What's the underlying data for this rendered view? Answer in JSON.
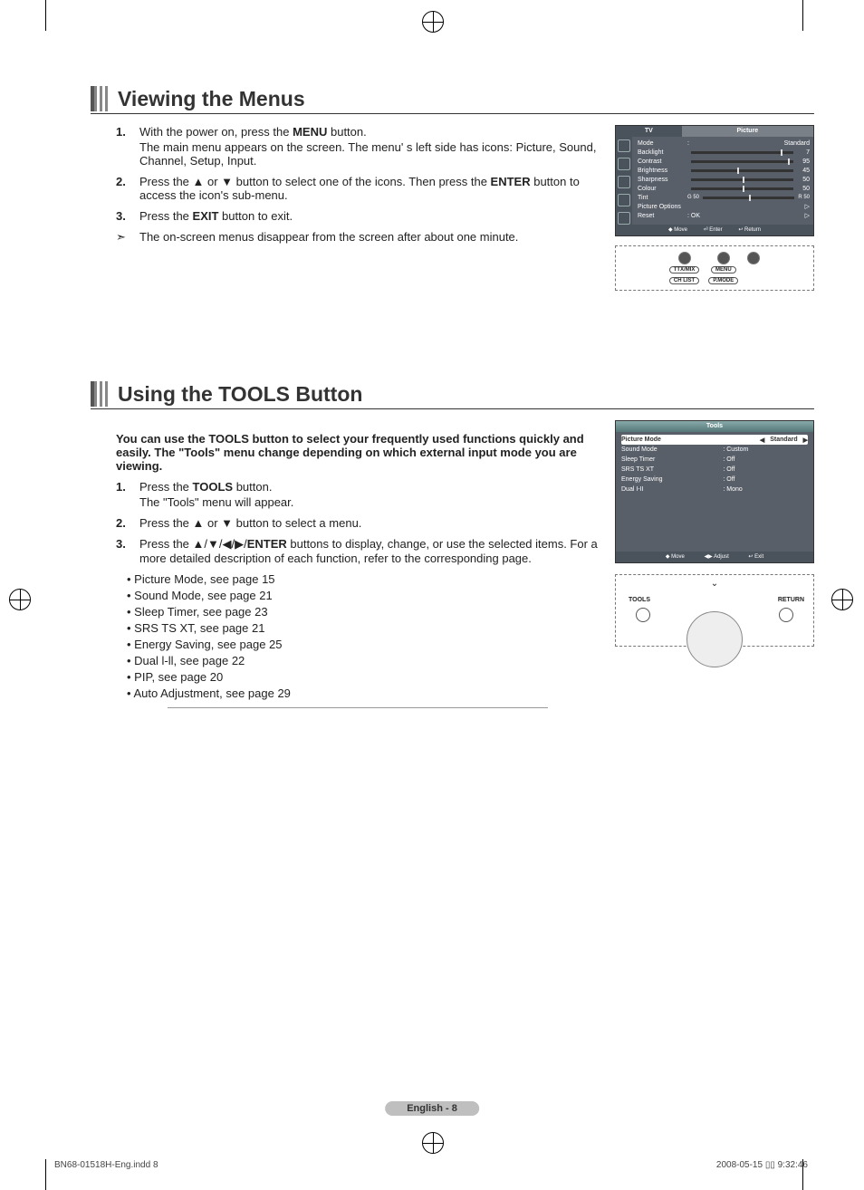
{
  "section1": {
    "title": "Viewing the Menus",
    "steps": [
      {
        "num": "1.",
        "lead": "With the power on, press the ",
        "bold": "MENU",
        "tail": " button.",
        "sub": "The main menu appears on the screen. The menu' s left side has icons: Picture, Sound, Channel, Setup, Input."
      },
      {
        "num": "2.",
        "lead": "Press the ▲ or ▼ button to select one of the icons. Then press the ",
        "bold": "ENTER",
        "tail": " button to access the icon's sub-menu.",
        "sub": ""
      },
      {
        "num": "3.",
        "lead": "Press the ",
        "bold": "EXIT",
        "tail": " button to exit.",
        "sub": ""
      }
    ],
    "note": "The on-screen menus disappear from the screen after about one minute.",
    "tv_tabs": [
      "TV",
      "Picture"
    ],
    "tv_rows": [
      {
        "label": "Mode",
        "sep": ":",
        "value": "Standard"
      },
      {
        "label": "Backlight",
        "value": "7",
        "knob": 88
      },
      {
        "label": "Contrast",
        "value": "95",
        "knob": 95
      },
      {
        "label": "Brightness",
        "value": "45",
        "knob": 45
      },
      {
        "label": "Sharpness",
        "value": "50",
        "knob": 50
      },
      {
        "label": "Colour",
        "value": "50",
        "knob": 50
      },
      {
        "label": "Tint",
        "prefix": "G 50",
        "suffix": "R 50",
        "knob": 50
      },
      {
        "label": "Picture Options",
        "value": "▷"
      },
      {
        "label": "Reset",
        "sep": ": OK",
        "value": "▷"
      }
    ],
    "tv_foot": [
      "◆ Move",
      "⏎ Enter",
      "↩ Return"
    ],
    "remote": [
      "TTX/MIX",
      "MENU",
      "CH LIST",
      "P.MODE"
    ]
  },
  "section2": {
    "title": "Using the TOOLS Button",
    "intro": "You can use the TOOLS button to select your frequently used functions quickly and easily. The \"Tools\" menu change depending on which external input mode you are viewing.",
    "steps": [
      {
        "num": "1.",
        "lead": "Press the ",
        "bold": "TOOLS",
        "tail": " button.",
        "sub": "The \"Tools\" menu will appear."
      },
      {
        "num": "2.",
        "lead": "Press the ▲ or ▼ button to select a menu.",
        "bold": "",
        "tail": "",
        "sub": ""
      },
      {
        "num": "3.",
        "lead": "Press the ▲/▼/◀/▶/",
        "bold": "ENTER",
        "tail": " buttons to display, change, or use the selected items. For a more detailed description of each function, refer to the corresponding page.",
        "sub": ""
      }
    ],
    "sublist": [
      "• Picture Mode, see page 15",
      "• Sound Mode, see page 21",
      "• Sleep Timer, see page 23",
      "• SRS TS XT, see page 21",
      "• Energy Saving, see page 25",
      "• Dual l-ll, see page 22",
      "• PIP, see page 20",
      "• Auto Adjustment, see page 29"
    ],
    "tools_title": "Tools",
    "tools_rows": [
      {
        "l": "Picture Mode",
        "r": "Standard",
        "sel": true
      },
      {
        "l": "Sound Mode",
        "r": ":  Custom"
      },
      {
        "l": "Sleep Timer",
        "r": ":  Off"
      },
      {
        "l": "SRS TS XT",
        "r": ":  Off"
      },
      {
        "l": "Energy Saving",
        "r": ":  Off"
      },
      {
        "l": "Dual I-II",
        "r": ":  Mono"
      }
    ],
    "tm_foot": [
      "◆ Move",
      "◀▶ Adjust",
      "↩ Exit"
    ],
    "remote_labels": {
      "left": "TOOLS",
      "right": "RETURN"
    }
  },
  "page_footer": "English - 8",
  "print_left": "BN68-01518H-Eng.indd   8",
  "print_right": "2008-05-15   ▯▯ 9:32:46"
}
